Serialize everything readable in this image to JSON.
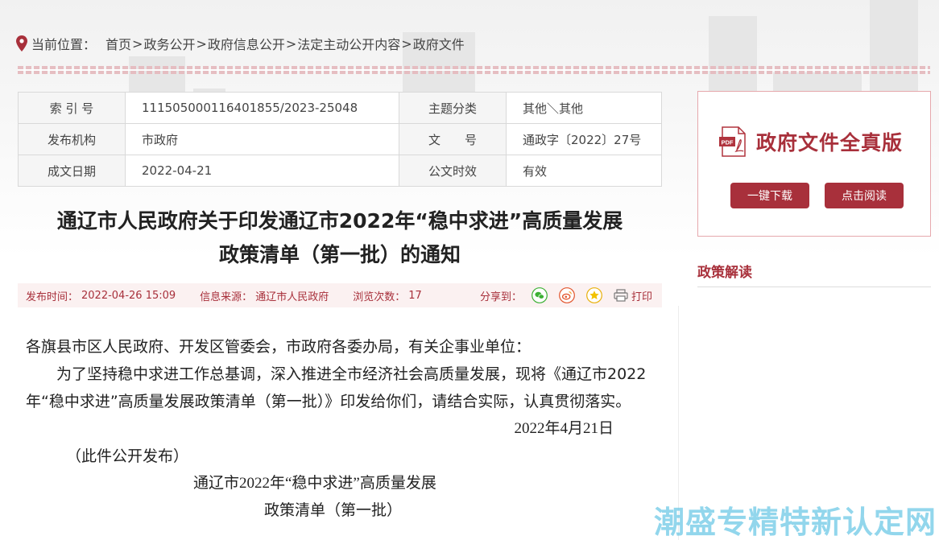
{
  "breadcrumb": {
    "prefix": "当前位置：",
    "items": [
      "首页",
      "政务公开",
      "政府信息公开",
      "法定主动公开内容",
      "政府文件"
    ],
    "separator": ">"
  },
  "meta": {
    "index_label": "索 引 号",
    "index_value": "111505000116401855/2023-25048",
    "category_label": "主题分类",
    "category_value": "其他＼其他",
    "publisher_label": "发布机构",
    "publisher_value": "市政府",
    "docno_label": "文　　号",
    "docno_value": "通政字〔2022〕27号",
    "date_label": "成文日期",
    "date_value": "2022-04-21",
    "validity_label": "公文时效",
    "validity_value": "有效"
  },
  "title": {
    "line1": "通辽市人民政府关于印发通辽市2022年“稳中求进”高质量发展",
    "line2": "政策清单（第一批）的通知"
  },
  "info_bar": {
    "pub_time_label": "发布时间：",
    "pub_time_value": "2022-04-26 15:09",
    "source_label": "信息来源：",
    "source_value": "通辽市人民政府",
    "views_label": "浏览次数：",
    "views_value": "17",
    "share_label": "分享到：",
    "print_label": "打印"
  },
  "content": {
    "salutation": "各旗县市区人民政府、开发区管委会，市政府各委办局，有关企事业单位：",
    "para1": "　　为了坚持稳中求进工作总基调，深入推进全市经济社会高质量发展，现将《通辽市2022年“稳中求进”高质量发展政策清单（第一批）》印发给你们，请结合实际，认真贯彻落实。",
    "sign_date": "2022年4月21日",
    "public_note": "（此件公开发布）",
    "attach_title1": "通辽市2022年“稳中求进”高质量发展",
    "attach_title2": "政策清单（第一批）"
  },
  "sidebar": {
    "doc_card_title": "政府文件全真版",
    "download_label": "一键下载",
    "read_label": "点击阅读",
    "interp_title": "政策解读"
  },
  "watermark": "潮盛专精特新认定网",
  "colors": {
    "accent": "#a8303b",
    "info_bg": "#fbf1f1",
    "watermark": "#6ec9e6"
  },
  "icons": {
    "location": "map-pin-icon",
    "wechat": "wechat-icon",
    "weibo": "weibo-icon",
    "qzone": "qzone-star-icon",
    "print": "printer-icon",
    "pdf": "pdf-file-icon"
  }
}
